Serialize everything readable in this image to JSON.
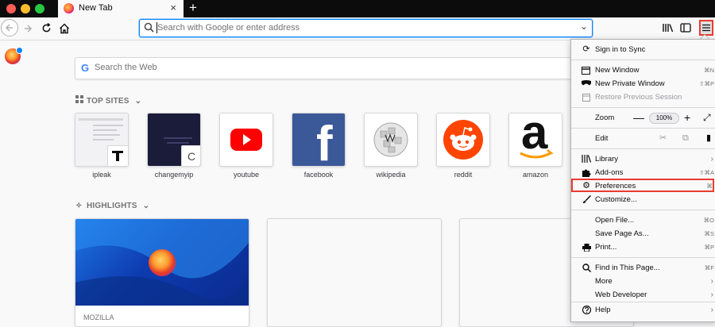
{
  "browser": {
    "tab_title": "New Tab",
    "tab_close": "×",
    "new_tab": "+",
    "url_placeholder": "Search with Google or enter address"
  },
  "newtab": {
    "search_placeholder": "Search the Web",
    "google_glyph": "G",
    "top_sites_heading": "TOP SITES",
    "highlights_heading": "HIGHLIGHTS",
    "top_sites": [
      {
        "label": "ipleak"
      },
      {
        "label": "changemyip",
        "overlay": "C"
      },
      {
        "label": "youtube"
      },
      {
        "label": "facebook",
        "glyph": "f"
      },
      {
        "label": "wikipedia"
      },
      {
        "label": "reddit"
      },
      {
        "label": "amazon",
        "glyph": "a"
      }
    ],
    "highlights": [
      {
        "source": "MOZILLA"
      }
    ]
  },
  "app_menu": {
    "sign_in": "Sign in to Sync",
    "new_window": "New Window",
    "new_window_shortcut": "⌘N",
    "new_private_window": "New Private Window",
    "new_private_shortcut": "⇧⌘P",
    "restore_session": "Restore Previous Session",
    "zoom_label": "Zoom",
    "zoom_minus": "—",
    "zoom_value": "100%",
    "zoom_plus": "+",
    "edit_label": "Edit",
    "library": "Library",
    "addons": "Add-ons",
    "addons_shortcut": "⇧⌘A",
    "preferences": "Preferences",
    "preferences_shortcut": "⌘,",
    "customize": "Customize...",
    "open_file": "Open File...",
    "open_file_shortcut": "⌘O",
    "save_page": "Save Page As...",
    "save_page_shortcut": "⌘S",
    "print": "Print...",
    "print_shortcut": "⌘P",
    "find": "Find in This Page...",
    "find_shortcut": "⌘F",
    "more": "More",
    "web_developer": "Web Developer",
    "help": "Help"
  },
  "colors": {
    "accent": "#0a84ff",
    "highlight_border": "#e93b2f",
    "youtube_red": "#ff0000",
    "facebook_blue": "#3b5998",
    "reddit_orange": "#ff4500"
  }
}
